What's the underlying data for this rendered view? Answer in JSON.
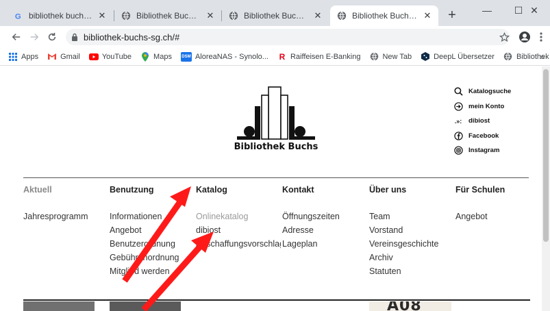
{
  "browser": {
    "tabs": [
      {
        "title": "bibliothek buchs sg - Go",
        "favicon": "google-icon",
        "active": false
      },
      {
        "title": "Bibliothek Buchs SG",
        "favicon": "globe-icon",
        "active": false
      },
      {
        "title": "Bibliothek Buchs Online K",
        "favicon": "globe-icon",
        "active": false
      },
      {
        "title": "Bibliothek Buchs SG",
        "favicon": "globe-icon",
        "active": true
      }
    ],
    "new_tab": "+",
    "window_controls": {
      "minimize": "—",
      "maximize": "☐",
      "close": "✕"
    },
    "url": "bibliothek-buchs-sg.ch/#",
    "bookmarks": [
      {
        "label": "Apps",
        "icon": "apps-grid-icon"
      },
      {
        "label": "Gmail",
        "icon": "gmail-icon"
      },
      {
        "label": "YouTube",
        "icon": "youtube-icon"
      },
      {
        "label": "Maps",
        "icon": "maps-pin-icon"
      },
      {
        "label": "AloreaNAS - Synolo...",
        "icon": "dsm-icon",
        "badge": "DSM"
      },
      {
        "label": "Raiffeisen E-Banking",
        "icon": "raiffeisen-icon",
        "badge": "R"
      },
      {
        "label": "New Tab",
        "icon": "globe-icon"
      },
      {
        "label": "DeepL Übersetzer",
        "icon": "deepl-icon"
      },
      {
        "label": "Bibliothek Buchs SG",
        "icon": "globe-icon"
      }
    ],
    "bookmarks_more": "»"
  },
  "site": {
    "logo_text": "Bibliothek Buchs",
    "quick_links": [
      {
        "label": "Katalogsuche",
        "icon": "search-icon"
      },
      {
        "label": "mein Konto",
        "icon": "login-icon"
      },
      {
        "label": "dibiost",
        "icon": "dibiost-icon",
        "glyph": ".»:"
      },
      {
        "label": "Facebook",
        "icon": "facebook-icon"
      },
      {
        "label": "Instagram",
        "icon": "instagram-icon"
      }
    ],
    "nav": [
      {
        "heading": "Aktuell",
        "items": [
          "Jahresprogramm"
        ]
      },
      {
        "heading": "Benutzung",
        "items": [
          "Informationen",
          "Angebot",
          "Benutzerordnung",
          "Gebührenordnung",
          "Mitglied werden"
        ]
      },
      {
        "heading": "Katalog",
        "items": [
          "Onlinekatalog",
          "dibiost",
          "Anschaffungsvorschlag"
        ]
      },
      {
        "heading": "Kontakt",
        "items": [
          "Öffnungszeiten",
          "Adresse",
          "Lageplan"
        ]
      },
      {
        "heading": "Über uns",
        "items": [
          "Team",
          "Vorstand",
          "Vereinsgeschichte",
          "Archiv",
          "Statuten"
        ]
      },
      {
        "heading": "Für Schulen",
        "items": [
          "Angebot"
        ]
      }
    ],
    "tile_text": "A08"
  },
  "colors": {
    "arrow": "#ff1a1a",
    "tab_strip": "#dee1e6",
    "dim_text": "#9a9a9a"
  }
}
